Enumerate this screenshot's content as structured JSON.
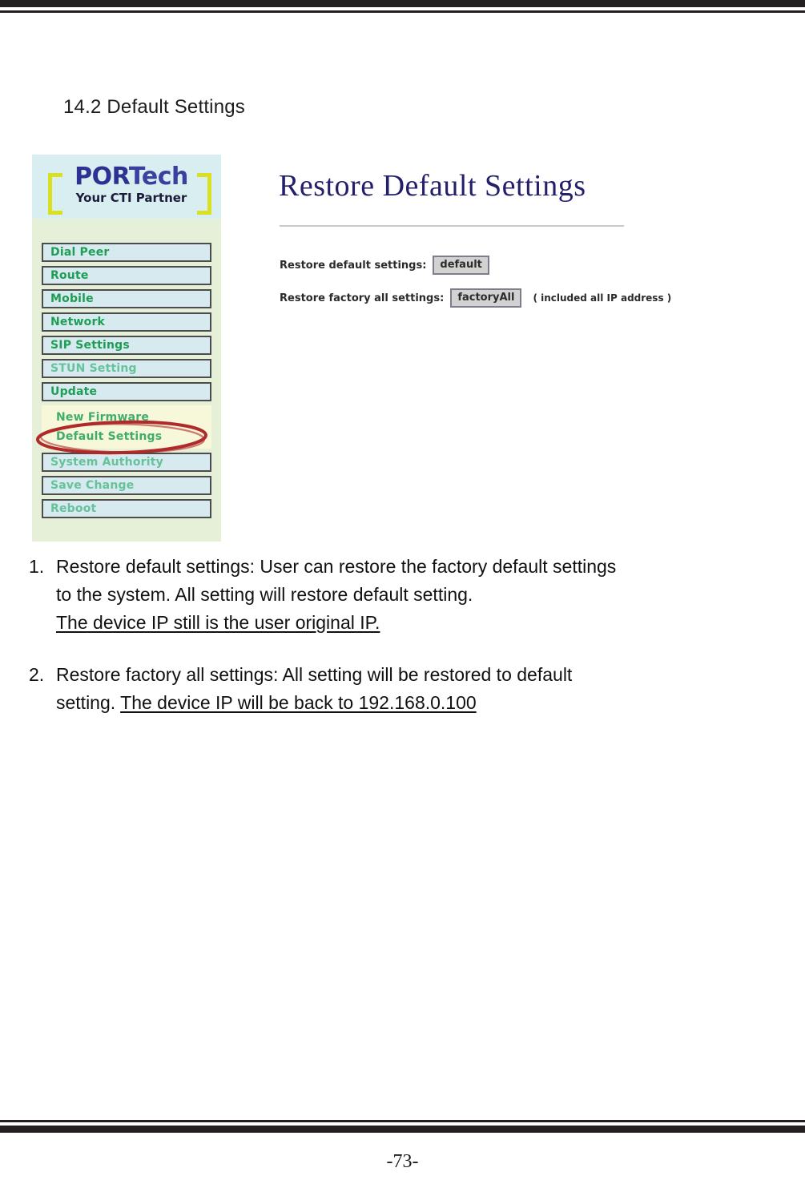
{
  "document": {
    "section_heading": "14.2 Default Settings",
    "page_number": "-73-"
  },
  "figure": {
    "logo": {
      "name_part1": "POR",
      "name_part2": "Tech",
      "tagline": "Your CTI Partner",
      "brand_color": "#2e3192",
      "bracket_color": "#d9e021",
      "band_color": "#d8eef0"
    },
    "sidebar": {
      "background_color": "#e6f0d8",
      "items": [
        {
          "label": "Dial Peer",
          "type": "button",
          "style": "normal"
        },
        {
          "label": "Route",
          "type": "button",
          "style": "normal"
        },
        {
          "label": "Mobile",
          "type": "button",
          "style": "normal"
        },
        {
          "label": "Network",
          "type": "button",
          "style": "normal"
        },
        {
          "label": "SIP Settings",
          "type": "button",
          "style": "normal"
        },
        {
          "label": "STUN Setting",
          "type": "button",
          "style": "light"
        },
        {
          "label": "Update",
          "type": "button",
          "style": "normal"
        }
      ],
      "submenu": [
        {
          "label": "New Firmware",
          "highlighted": false
        },
        {
          "label": "Default Settings",
          "highlighted": true
        }
      ],
      "items_after": [
        {
          "label": "System Authority",
          "type": "button",
          "style": "light"
        },
        {
          "label": "Save Change",
          "type": "button",
          "style": "light"
        },
        {
          "label": "Reboot",
          "type": "button",
          "style": "light"
        }
      ],
      "annotation": {
        "shape": "hand-drawn-oval",
        "color": "#b02a2a",
        "targets": "Default Settings"
      }
    },
    "main": {
      "title": "Restore Default Settings",
      "title_color": "#231f6b",
      "rows": [
        {
          "label": "Restore default settings:",
          "button": "default",
          "note": ""
        },
        {
          "label": "Restore factory all settings:",
          "button": "factoryAll",
          "note": "( included all IP address )"
        }
      ]
    }
  },
  "body": {
    "items": [
      {
        "number": "1.",
        "line1": "Restore default settings: User can restore the factory default settings",
        "line2": "to the system. All setting will restore default setting.",
        "line3_underlined": "The device IP still is the user original IP."
      },
      {
        "number": "2.",
        "line1": "Restore factory all settings: All setting will be restored to default",
        "line2_prefix": "setting. ",
        "line2_underlined": "The device IP will be back to 192.168.0.100"
      }
    ]
  }
}
